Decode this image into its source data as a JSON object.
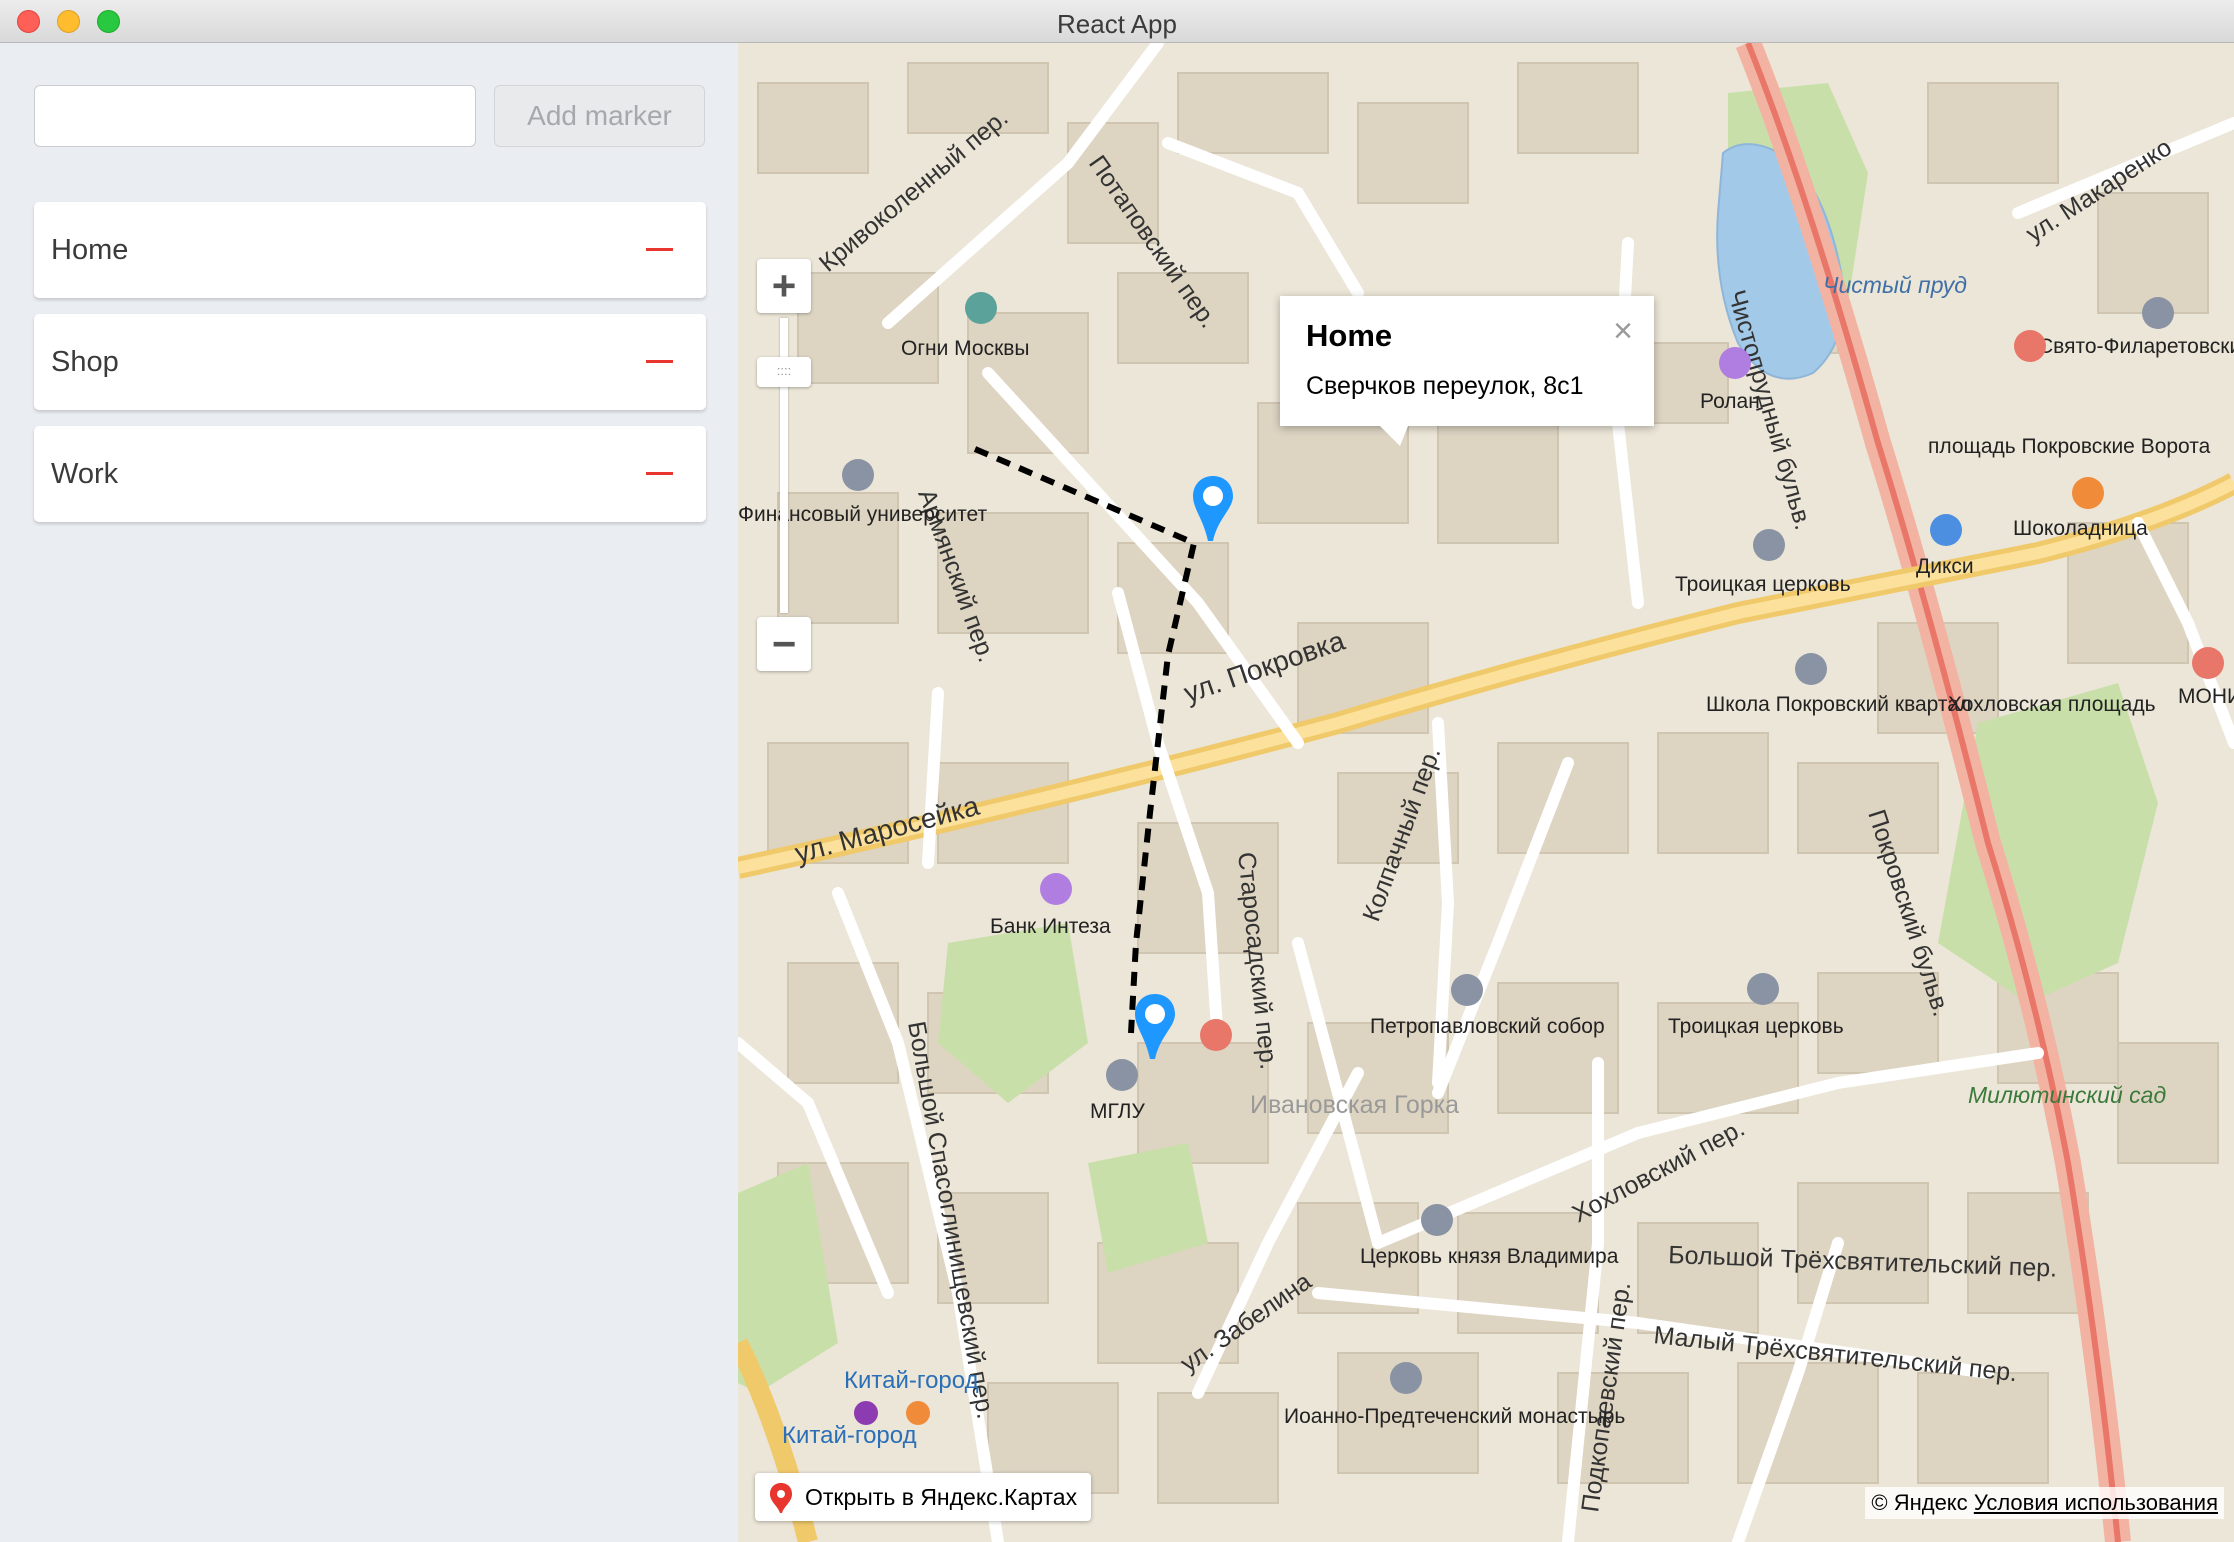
{
  "window": {
    "title": "React App"
  },
  "sidebar": {
    "input": {
      "value": "",
      "placeholder": ""
    },
    "add_button_label": "Add marker",
    "markers": [
      {
        "label": "Home"
      },
      {
        "label": "Shop"
      },
      {
        "label": "Work"
      }
    ],
    "remove_icon": "minus-icon"
  },
  "map": {
    "controls": {
      "zoom_in": "+",
      "zoom_out": "−",
      "zoom_handle": "::::"
    },
    "balloon": {
      "title": "Home",
      "address": "Сверчков переулок, 8с1",
      "close": "×"
    },
    "open_in_app": "Открыть в Яндекс.Картах",
    "copyright": "© Яндекс",
    "terms_link": "Условия использования",
    "street_labels": {
      "pokrovka": "ул. Покровка",
      "maroseyka": "ул. Маросейка",
      "armyansky": "Армянский пер.",
      "krivokolenny": "Кривоколенный пер.",
      "potapovsky": "Потаповский пер.",
      "chistoprudny": "Чистопрудный бульв.",
      "pokrovsky_blvd": "Покровский бульв.",
      "starosadsky": "Старосадский пер.",
      "kolpachny": "Колпачный пер.",
      "khokhlovsky": "Хохловский пер.",
      "spasogl": "Большой Спасоглинищевский пер.",
      "zabelina": "ул. Забелина",
      "bolshoy_trekh": "Большой Трёхсвятительский пер.",
      "maly_trekh": "Малый Трёхсвятительский пер.",
      "makarenko": "ул. Макаренко",
      "podkolok": "Подкопаевский пер."
    },
    "pois": {
      "ogni": "Огни Москвы",
      "finuni": "Финансовый университет",
      "rolan": "Ролан",
      "troitskaya1": "Троицкая церковь",
      "troitskaya2": "Троицкая церковь",
      "school": "Школа Покровский квартал",
      "dixi": "Дикси",
      "shokoladnitsa": "Шоколадница",
      "khokh_sq": "Хохловская площадь",
      "pokr_vorota": "площадь Покровские Ворота",
      "bank": "Банк Интеза",
      "petropavl": "Петропавловский собор",
      "mglu": "МГЛУ",
      "ivanovskaya": "Ивановская Горка",
      "tserkov_vlad": "Церковь князя Владимира",
      "ioanno": "Иоанно-Предтеченский монастырь",
      "kitay1": "Китай-город",
      "kitay2": "Китай-город",
      "milyutinsky": "Милютинский сад",
      "chisty_prud": "Чистый пруд",
      "svyato": "Свято-Филаретовский институт",
      "monik": "МОНИК"
    }
  }
}
